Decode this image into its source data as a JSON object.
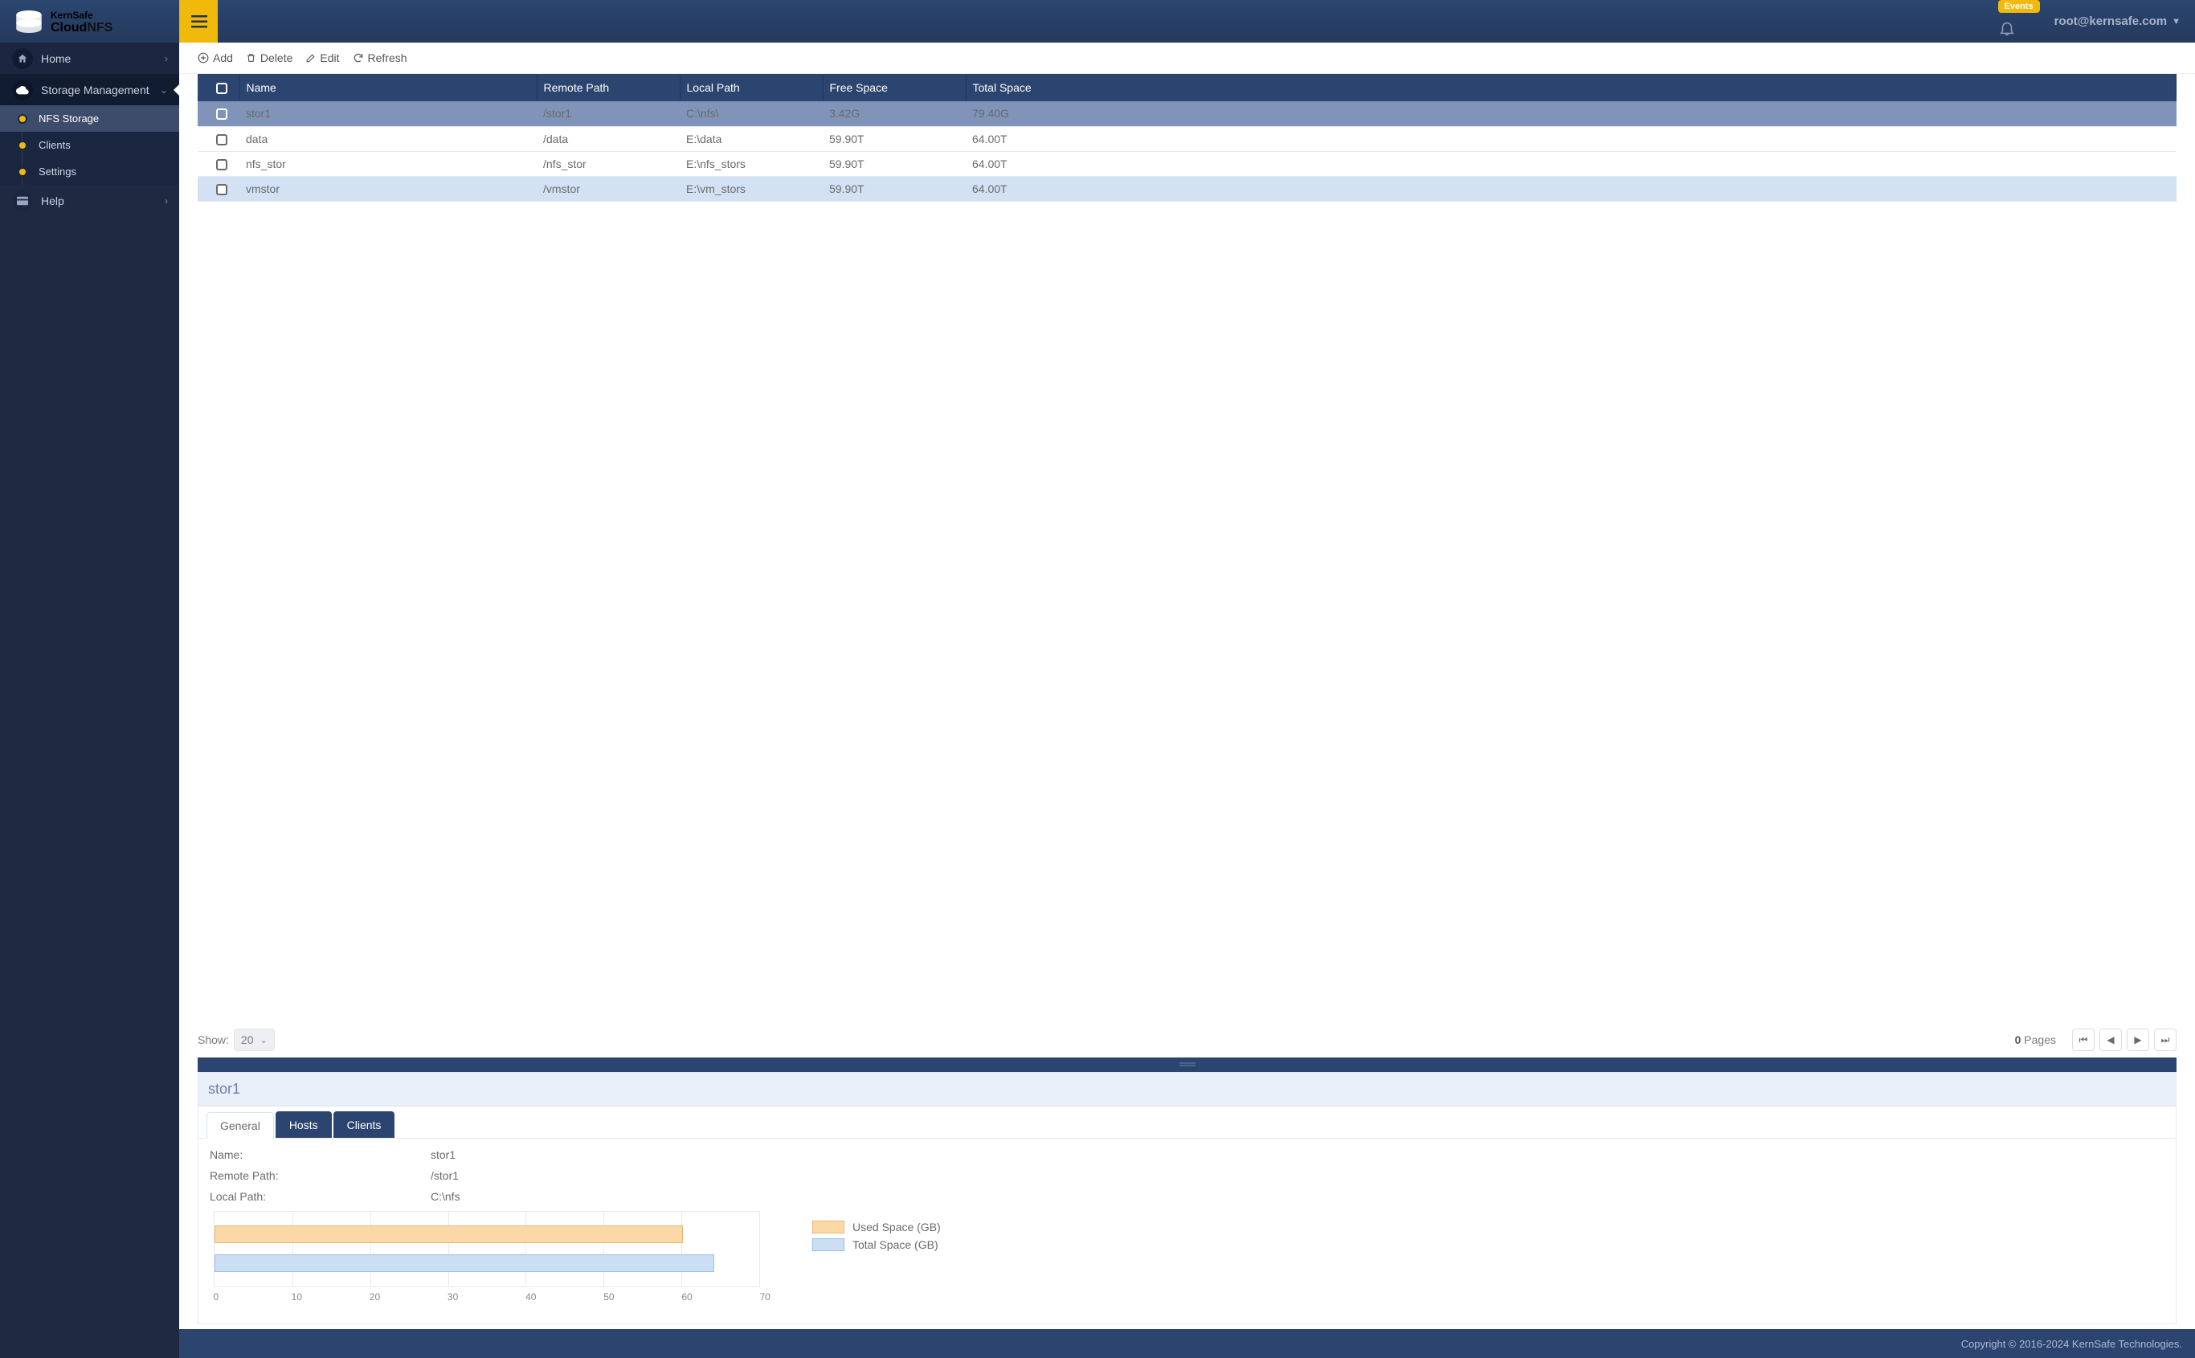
{
  "brand": {
    "top": "KernSafe",
    "cloud": "Cloud",
    "nfs": "NFS"
  },
  "header": {
    "events_badge": "Events",
    "user": "root@kernsafe.com"
  },
  "sidebar": {
    "home": "Home",
    "storage_mgmt": "Storage Management",
    "sub": {
      "nfs": "NFS Storage",
      "clients": "Clients",
      "settings": "Settings"
    },
    "help": "Help"
  },
  "toolbar": {
    "add": "Add",
    "delete": "Delete",
    "edit": "Edit",
    "refresh": "Refresh"
  },
  "columns": {
    "name": "Name",
    "remote": "Remote Path",
    "local": "Local Path",
    "free": "Free Space",
    "total": "Total Space"
  },
  "rows": [
    {
      "name": "stor1",
      "remote": "/stor1",
      "local": "C:\\nfs\\",
      "free": "3.42G",
      "total": "79.40G"
    },
    {
      "name": "data",
      "remote": "/data",
      "local": "E:\\data",
      "free": "59.90T",
      "total": "64.00T"
    },
    {
      "name": "nfs_stor",
      "remote": "/nfs_stor",
      "local": "E:\\nfs_stors",
      "free": "59.90T",
      "total": "64.00T"
    },
    {
      "name": "vmstor",
      "remote": "/vmstor",
      "local": "E:\\vm_stors",
      "free": "59.90T",
      "total": "64.00T"
    }
  ],
  "pager": {
    "show_label": "Show:",
    "show_value": "20",
    "pages_count": "0",
    "pages_label": "Pages"
  },
  "detail": {
    "title": "stor1",
    "tabs": {
      "general": "General",
      "hosts": "Hosts",
      "clients": "Clients"
    },
    "labels": {
      "name": "Name:",
      "remote": "Remote Path:",
      "local": "Local Path:"
    },
    "values": {
      "name": "stor1",
      "remote": "/stor1",
      "local": "C:\\nfs"
    },
    "legend": {
      "used": "Used Space (GB)",
      "total": "Total Space (GB)"
    }
  },
  "footer": "Copyright © 2016-2024 KernSafe Technologies.",
  "chart_data": {
    "type": "bar",
    "orientation": "horizontal",
    "series": [
      {
        "name": "Used Space (GB)",
        "values": [
          60
        ]
      },
      {
        "name": "Total Space (GB)",
        "values": [
          64
        ]
      }
    ],
    "xlim": [
      0,
      70
    ],
    "xticks": [
      0,
      10,
      20,
      30,
      40,
      50,
      60,
      70
    ],
    "title": "",
    "xlabel": "",
    "ylabel": ""
  }
}
